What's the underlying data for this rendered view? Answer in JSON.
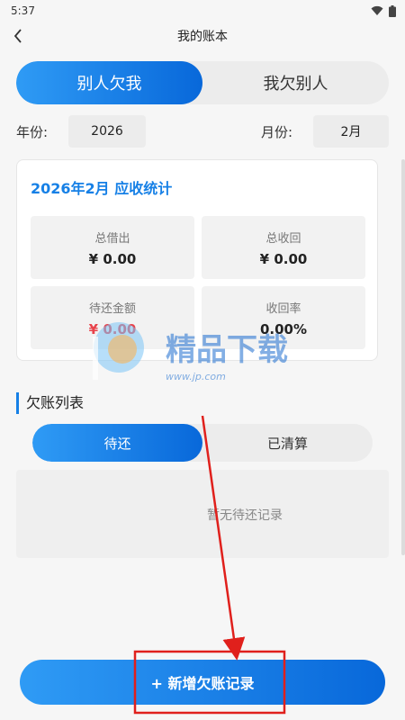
{
  "status_bar": {
    "time": "5:37"
  },
  "header": {
    "title": "我的账本"
  },
  "main_tabs": [
    {
      "label": "别人欠我",
      "active": true
    },
    {
      "label": "我欠别人",
      "active": false
    }
  ],
  "filters": {
    "year_label": "年份:",
    "year_value": "2026",
    "month_label": "月份:",
    "month_value": "2月"
  },
  "stats": {
    "title": "2026年2月 应收统计",
    "items": [
      {
        "label": "总借出",
        "value": "¥ 0.00"
      },
      {
        "label": "总收回",
        "value": "¥ 0.00"
      },
      {
        "label": "待还金额",
        "value": "¥ 0.00"
      },
      {
        "label": "收回率",
        "value": "0.00%"
      }
    ]
  },
  "watermark": {
    "text": "精品下载",
    "subtext": "www.jp.com"
  },
  "list_section": {
    "title": "欠账列表",
    "tabs": [
      {
        "label": "待还",
        "active": true
      },
      {
        "label": "已清算",
        "active": false
      }
    ],
    "empty_text": "暂无待还记录"
  },
  "add_button": {
    "label": "+ 新增欠账记录"
  },
  "colors": {
    "accent": "#1680e6",
    "gradient_start": "#2f9bf5",
    "gradient_end": "#0868da",
    "negative": "#e8434b",
    "annotation": "#e0201c"
  }
}
